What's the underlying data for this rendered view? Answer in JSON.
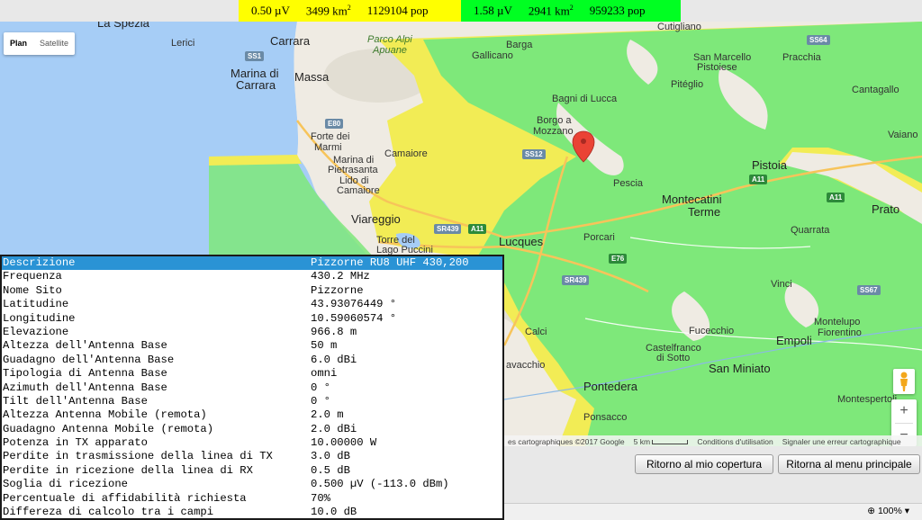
{
  "legend": {
    "yellow": {
      "color": "#ffff00",
      "field": "0.50 µV",
      "area_num": "3499 km",
      "area_sup": "2",
      "pop": "1129104 pop"
    },
    "green": {
      "color": "#00ff22",
      "field": "1.58 µV",
      "area_num": "2941 km",
      "area_sup": "2",
      "pop": "959233 pop"
    }
  },
  "map": {
    "type_plan": "Plan",
    "type_satellite": "Satellite",
    "attribution": "es cartographiques ©2017 Google",
    "scale": "5 km",
    "terms": "Conditions d'utilisation",
    "report": "Signaler une erreur cartographique",
    "zoom_in": "+",
    "zoom_out": "−",
    "places": [
      {
        "name": "La Spezia"
      },
      {
        "name": "Lerici"
      },
      {
        "name": "Carrara"
      },
      {
        "name": "Parco Alpi"
      },
      {
        "name": "Apuane"
      },
      {
        "name": "Barga"
      },
      {
        "name": "Gallicano"
      },
      {
        "name": "Cutigliano"
      },
      {
        "name": "San Marcello"
      },
      {
        "name": "Pistoiese"
      },
      {
        "name": "Pracchia"
      },
      {
        "name": "Marina di"
      },
      {
        "name": "Carrara"
      },
      {
        "name": "Massa"
      },
      {
        "name": "Pitéglio"
      },
      {
        "name": "Cantagallo"
      },
      {
        "name": "Bagni di Lucca"
      },
      {
        "name": "Forte dei"
      },
      {
        "name": "Marmi"
      },
      {
        "name": "Borgo a"
      },
      {
        "name": "Mozzano"
      },
      {
        "name": "Camaiore"
      },
      {
        "name": "Marina di"
      },
      {
        "name": "Pietrasanta"
      },
      {
        "name": "Vaiano"
      },
      {
        "name": "Pistoia"
      },
      {
        "name": "Lido di"
      },
      {
        "name": "Camaiore"
      },
      {
        "name": "Pescia"
      },
      {
        "name": "Montecatini"
      },
      {
        "name": "Terme"
      },
      {
        "name": "Viareggio"
      },
      {
        "name": "Prato"
      },
      {
        "name": "Lucques"
      },
      {
        "name": "Porcari"
      },
      {
        "name": "Quarrata"
      },
      {
        "name": "Torre del"
      },
      {
        "name": "Lago Puccini"
      },
      {
        "name": "Vinci"
      },
      {
        "name": "Calci"
      },
      {
        "name": "Montelupo"
      },
      {
        "name": "Fiorentino"
      },
      {
        "name": "Fucecchio"
      },
      {
        "name": "Empoli"
      },
      {
        "name": "Castelfranco"
      },
      {
        "name": "di Sotto"
      },
      {
        "name": "San Miniato"
      },
      {
        "name": "avacchio"
      },
      {
        "name": "Pontedera"
      },
      {
        "name": "Montespertoli"
      },
      {
        "name": "Ponsacco"
      }
    ],
    "shields": [
      "SS1",
      "SS64",
      "E80",
      "SS12",
      "A11",
      "A11",
      "SR439",
      "A11",
      "E76",
      "SR439",
      "SS67"
    ]
  },
  "panel": {
    "rows": [
      {
        "k": "Descrizione",
        "v": "Pizzorne RU8 UHF 430,200"
      },
      {
        "k": "Frequenza",
        "v": "430.2 MHz"
      },
      {
        "k": "Nome Sito",
        "v": "Pizzorne"
      },
      {
        "k": "Latitudine",
        "v": "43.93076449 °"
      },
      {
        "k": "Longitudine",
        "v": "10.59060574 °"
      },
      {
        "k": "Elevazione",
        "v": "966.8 m"
      },
      {
        "k": "Altezza dell'Antenna Base",
        "v": "50 m"
      },
      {
        "k": "Guadagno dell'Antenna Base",
        "v": "6.0 dBi"
      },
      {
        "k": "Tipologia di Antenna Base",
        "v": "omni"
      },
      {
        "k": "Azimuth dell'Antenna Base",
        "v": "0 °"
      },
      {
        "k": "Tilt dell'Antenna Base",
        "v": "0 °"
      },
      {
        "k": "Altezza Antenna Mobile (remota)",
        "v": "2.0 m"
      },
      {
        "k": "Guadagno Antenna Mobile (remota)",
        "v": "2.0 dBi"
      },
      {
        "k": "Potenza in TX apparato",
        "v": "10.00000 W"
      },
      {
        "k": "Perdite in trasmissione della linea di TX",
        "v": "3.0 dB"
      },
      {
        "k": "Perdite in ricezione della linea di RX",
        "v": "0.5 dB"
      },
      {
        "k": "Soglia di ricezione",
        "v": "0.500 µV (-113.0 dBm)"
      },
      {
        "k": "Percentuale di affidabilità richiesta",
        "v": "70%"
      },
      {
        "k": "Differeza di calcolo tra i campi",
        "v": "10.0 dB"
      }
    ]
  },
  "buttons": {
    "back_coverage": "Ritorno al mio copertura",
    "back_menu": "Ritorna al menu principale"
  },
  "status": {
    "zoom": "100%"
  }
}
